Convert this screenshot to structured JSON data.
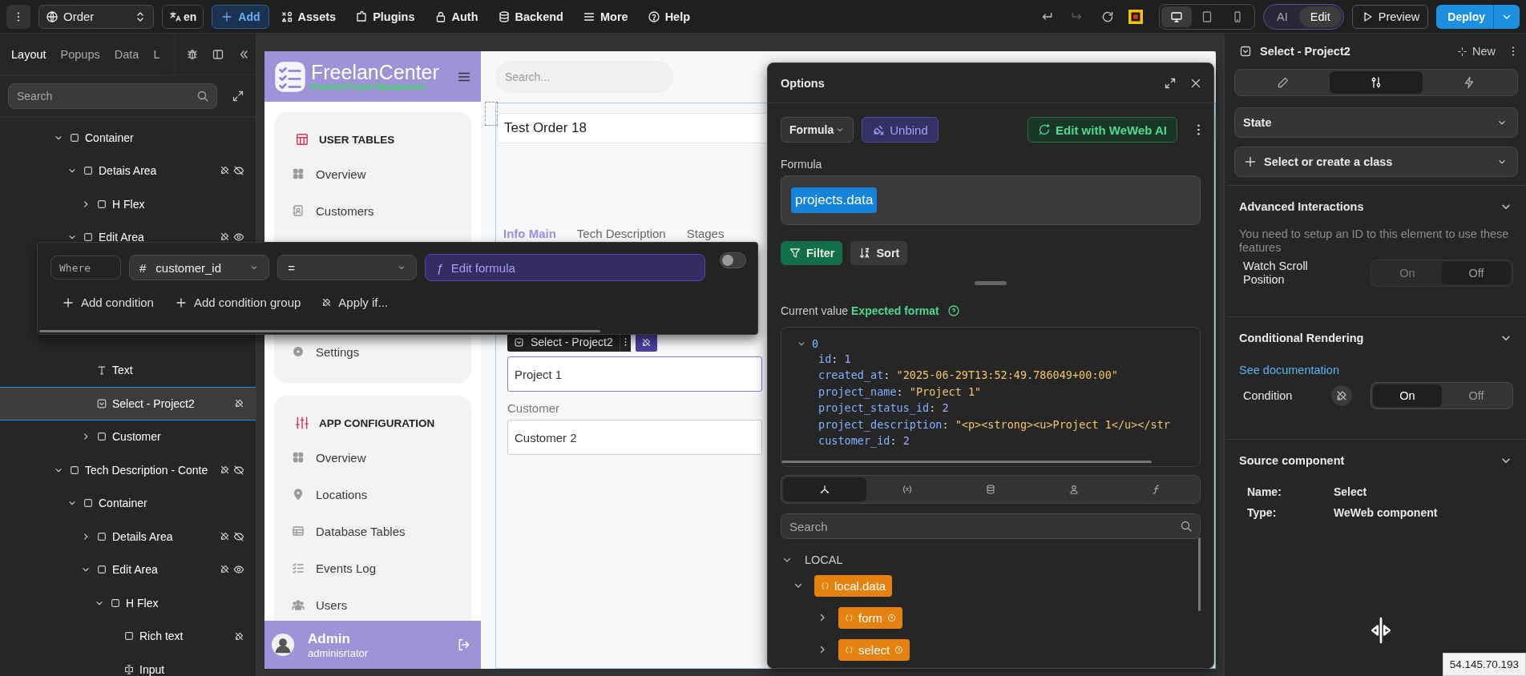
{
  "topbar": {
    "page_select": {
      "label": "Order"
    },
    "language_button": {
      "label": "en"
    },
    "add_button": {
      "label": "Add"
    },
    "menu_items": [
      {
        "label": "Assets",
        "kind": "assets"
      },
      {
        "label": "Plugins",
        "kind": "plugins"
      },
      {
        "label": "Auth",
        "kind": "auth"
      },
      {
        "label": "Backend",
        "kind": "backend"
      },
      {
        "label": "More",
        "kind": "more"
      },
      {
        "label": "Help",
        "kind": "help"
      }
    ],
    "history": [
      {
        "kind": "undo",
        "disabled": false
      },
      {
        "kind": "redo",
        "disabled": true
      },
      {
        "kind": "refresh",
        "disabled": false
      }
    ],
    "devices": [
      {
        "kind": "desktop",
        "selected": true
      },
      {
        "kind": "tablet",
        "selected": false
      },
      {
        "kind": "mobile",
        "selected": false
      }
    ],
    "modes": [
      {
        "label": "AI",
        "selected": false
      },
      {
        "label": "Edit",
        "selected": true
      }
    ],
    "preview_button": {
      "label": "Preview"
    },
    "deploy_button": {
      "label": "Deploy"
    }
  },
  "left_panel": {
    "tabs": [
      {
        "label": "Layout",
        "selected": true
      },
      {
        "label": "Popups",
        "selected": false
      },
      {
        "label": "Data",
        "selected": false
      },
      {
        "label": "L",
        "selected": false
      }
    ],
    "search": {
      "placeholder": "Search"
    },
    "tree": [
      {
        "label": "Container",
        "kind": "container",
        "selected": false,
        "expanded": true,
        "children": [
          {
            "label": "Detais Area",
            "kind": "container",
            "selected": false,
            "expanded": true,
            "bound": true,
            "visible": false,
            "children": [
              {
                "label": "H Flex",
                "kind": "container",
                "selected": false,
                "expanded": false
              }
            ]
          },
          {
            "label": "Edit Area",
            "kind": "container",
            "selected": false,
            "expanded": true,
            "bound": true,
            "visible": true,
            "children": [
              {
                "label": "Text",
                "kind": "text",
                "selected": false
              },
              {
                "label": "Select - Project2",
                "kind": "select",
                "selected": true,
                "bound": true
              },
              {
                "label": "Customer",
                "kind": "container",
                "selected": false,
                "expanded": false
              }
            ]
          }
        ]
      },
      {
        "label": "Tech Description - Conte",
        "kind": "container",
        "selected": false,
        "expanded": true,
        "bound": true,
        "visible": false,
        "children": [
          {
            "label": "Container",
            "kind": "container",
            "selected": false,
            "expanded": true,
            "children": [
              {
                "label": "Details Area",
                "kind": "container",
                "selected": false,
                "expanded": false,
                "bound": true,
                "visible": false
              },
              {
                "label": "Edit Area",
                "kind": "container",
                "selected": false,
                "expanded": true,
                "bound": true,
                "visible": true,
                "children": [
                  {
                    "label": "H Flex",
                    "kind": "container",
                    "selected": false,
                    "expanded": true,
                    "children": [
                      {
                        "label": "Rich text",
                        "kind": "container",
                        "selected": false,
                        "bound": true
                      },
                      {
                        "label": "Input",
                        "kind": "input",
                        "selected": false
                      }
                    ]
                  }
                ]
              }
            ]
          }
        ]
      }
    ]
  },
  "app": {
    "brand": {
      "name": "FreelanCenter",
      "tagline": "Powerful Project Management"
    },
    "nav_sections": [
      {
        "title": "USER TABLES",
        "kind": "tables",
        "items": [
          {
            "label": "Overview",
            "kind": "grid"
          },
          {
            "label": "Customers",
            "kind": "contacts"
          },
          {
            "label": "Settings",
            "kind": "gear"
          }
        ]
      },
      {
        "title": "APP CONFIGURATION",
        "kind": "sliders",
        "items": [
          {
            "label": "Overview",
            "kind": "grid"
          },
          {
            "label": "Locations",
            "kind": "pin"
          },
          {
            "label": "Database Tables",
            "kind": "table"
          },
          {
            "label": "Events Log",
            "kind": "checklist"
          },
          {
            "label": "Users",
            "kind": "people"
          }
        ]
      }
    ],
    "user": {
      "name": "Admin",
      "role": "adminisrtator"
    },
    "search": {
      "placeholder": "Search..."
    },
    "order_title": "Test Order 18",
    "tabs": [
      {
        "label": "Info Main",
        "selected": true
      },
      {
        "label": "Tech Description",
        "selected": false
      },
      {
        "label": "Stages",
        "selected": false
      }
    ],
    "element_tag": {
      "label": "Select - Project2"
    },
    "fields": [
      {
        "value": "Project 1",
        "selected": true
      },
      {
        "label": "Customer",
        "value": "Customer 2",
        "selected": false
      }
    ]
  },
  "options_panel": {
    "title": "Options",
    "mode_select": {
      "label": "Formula"
    },
    "unbind_button": {
      "label": "Unbind"
    },
    "ai_button": {
      "label": "Edit with WeWeb AI"
    },
    "formula_label": "Formula",
    "formula": "projects.data",
    "actions": [
      {
        "label": "Filter",
        "kind": "filter",
        "selected": true
      },
      {
        "label": "Sort",
        "kind": "sort",
        "selected": false
      }
    ],
    "current_value_label": "Current value",
    "expected_format_link": "Expected format",
    "value_tree": {
      "index": "0",
      "expanded": true,
      "fields": [
        {
          "key": "id",
          "sep": ":",
          "value": "1",
          "kind": "number"
        },
        {
          "key": "created_at",
          "sep": ":",
          "value": "\"2025-06-29T13:52:49.786049+00:00\"",
          "kind": "string"
        },
        {
          "key": "project_name",
          "sep": ":",
          "value": "\"Project 1\"",
          "kind": "string"
        },
        {
          "key": "project_status_id",
          "sep": ":",
          "value": "2",
          "kind": "number"
        },
        {
          "key": "project_description",
          "sep": ":",
          "value": "\"<p><strong><u>Project 1</u></str",
          "kind": "string"
        },
        {
          "key": "customer_id",
          "sep": ":",
          "value": "2",
          "kind": "number"
        }
      ]
    },
    "source_tabs": [
      {
        "kind": "components",
        "selected": true
      },
      {
        "kind": "variables",
        "selected": false
      },
      {
        "kind": "data",
        "selected": false
      },
      {
        "kind": "user",
        "selected": false
      },
      {
        "kind": "formulas",
        "selected": false
      }
    ],
    "search": {
      "placeholder": "Search"
    },
    "section": {
      "label": "LOCAL",
      "expanded": true
    },
    "variables": [
      {
        "label": "local.data",
        "expanded": true,
        "children": [
          {
            "label": "form",
            "expanded": false,
            "help": true
          },
          {
            "label": "select",
            "expanded": false,
            "help": true
          }
        ]
      }
    ]
  },
  "filter_popup": {
    "where": {
      "placeholder": "Where"
    },
    "field_select": {
      "type_icon": "#",
      "label": "customer_id"
    },
    "operator_select": {
      "label": "="
    },
    "formula_button": {
      "icon": "ƒ",
      "label": "Edit formula"
    },
    "toggle_on": false,
    "actions": [
      {
        "label": "Add condition",
        "kind": "add"
      },
      {
        "label": "Add condition group",
        "kind": "add"
      },
      {
        "label": "Apply if...",
        "kind": "bind"
      }
    ]
  },
  "right_panel": {
    "title": "Select - Project2",
    "new_button": {
      "label": "New"
    },
    "view_tabs": [
      {
        "kind": "edit",
        "selected": false
      },
      {
        "kind": "settings",
        "selected": true
      },
      {
        "kind": "workflows",
        "selected": false
      }
    ],
    "state_select": {
      "label": "State"
    },
    "class_select": {
      "label": "Select or create a class"
    },
    "sections": [
      {
        "title": "Advanced Interactions",
        "note": "You need to setup an ID to this element to use these features",
        "toggles": [
          {
            "label": "Watch Scroll Position",
            "bindable": false,
            "disabled": true,
            "options": [
              {
                "label": "On",
                "selected": false
              },
              {
                "label": "Off",
                "selected": true
              }
            ]
          }
        ]
      },
      {
        "title": "Conditional Rendering",
        "link": "See documentation",
        "toggles": [
          {
            "label": "Condition",
            "bindable": true,
            "disabled": false,
            "options": [
              {
                "label": "On",
                "selected": true
              },
              {
                "label": "Off",
                "selected": false
              }
            ]
          }
        ]
      },
      {
        "title": "Source component",
        "props": [
          {
            "key": "Name:",
            "value": "Select"
          },
          {
            "key": "Type:",
            "value": "WeWeb component"
          }
        ]
      }
    ]
  },
  "ip_tooltip": "54.145.70.193"
}
